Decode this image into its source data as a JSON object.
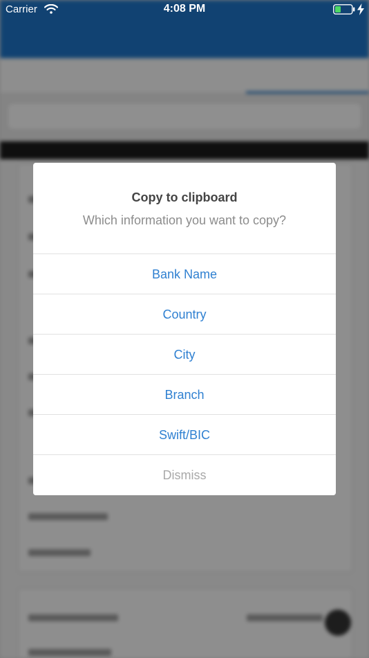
{
  "status_bar": {
    "carrier": "Carrier",
    "time": "4:08 PM",
    "icons": [
      "wifi-icon",
      "battery-icon",
      "charging-bolt-icon"
    ]
  },
  "dialog": {
    "title": "Copy to clipboard",
    "message": "Which information you want to copy?",
    "options": [
      {
        "label": "Bank Name"
      },
      {
        "label": "Country"
      },
      {
        "label": "City"
      },
      {
        "label": "Branch"
      },
      {
        "label": "Swift/BIC"
      }
    ],
    "dismiss_label": "Dismiss"
  },
  "colors": {
    "accent": "#2f80d1",
    "brand_bar": "#1e73c4",
    "dismiss": "#a9a9a9"
  }
}
